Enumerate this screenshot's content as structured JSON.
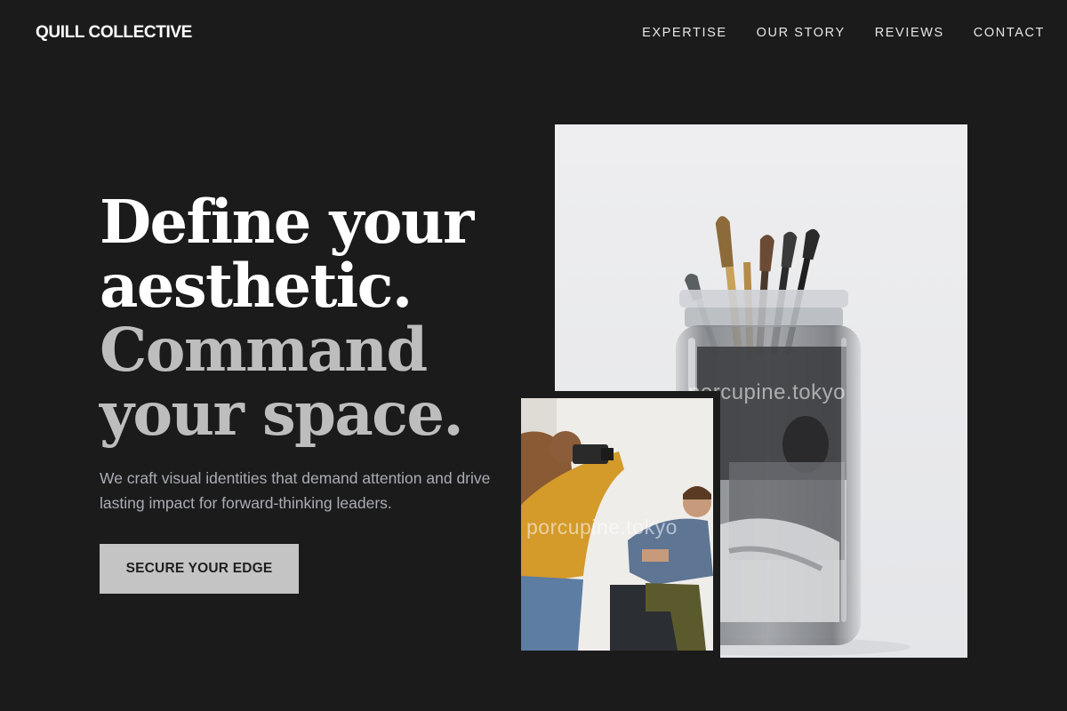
{
  "brand": {
    "name": "QUILL COLLECTIVE"
  },
  "nav": {
    "items": [
      {
        "label": "EXPERTISE"
      },
      {
        "label": "OUR STORY"
      },
      {
        "label": "REVIEWS"
      },
      {
        "label": "CONTACT"
      }
    ]
  },
  "hero": {
    "headline_lines": [
      "Define your",
      "aesthetic.",
      "Command",
      "your space."
    ],
    "subtitle": "We craft visual identities that demand attention and drive lasting impact for forward-thinking leaders.",
    "cta_label": "SECURE YOUR EDGE"
  },
  "images": {
    "main_watermark": "porcupine.tokyo",
    "small_watermark": "porcupine.tokyo"
  },
  "colors": {
    "background": "#1b1b1b",
    "headline_primary": "#ffffff",
    "headline_secondary": "#bdbdbd",
    "subtitle": "#a9adb4",
    "cta_background": "#c4c4c4",
    "cta_text": "#1f1f1f"
  }
}
